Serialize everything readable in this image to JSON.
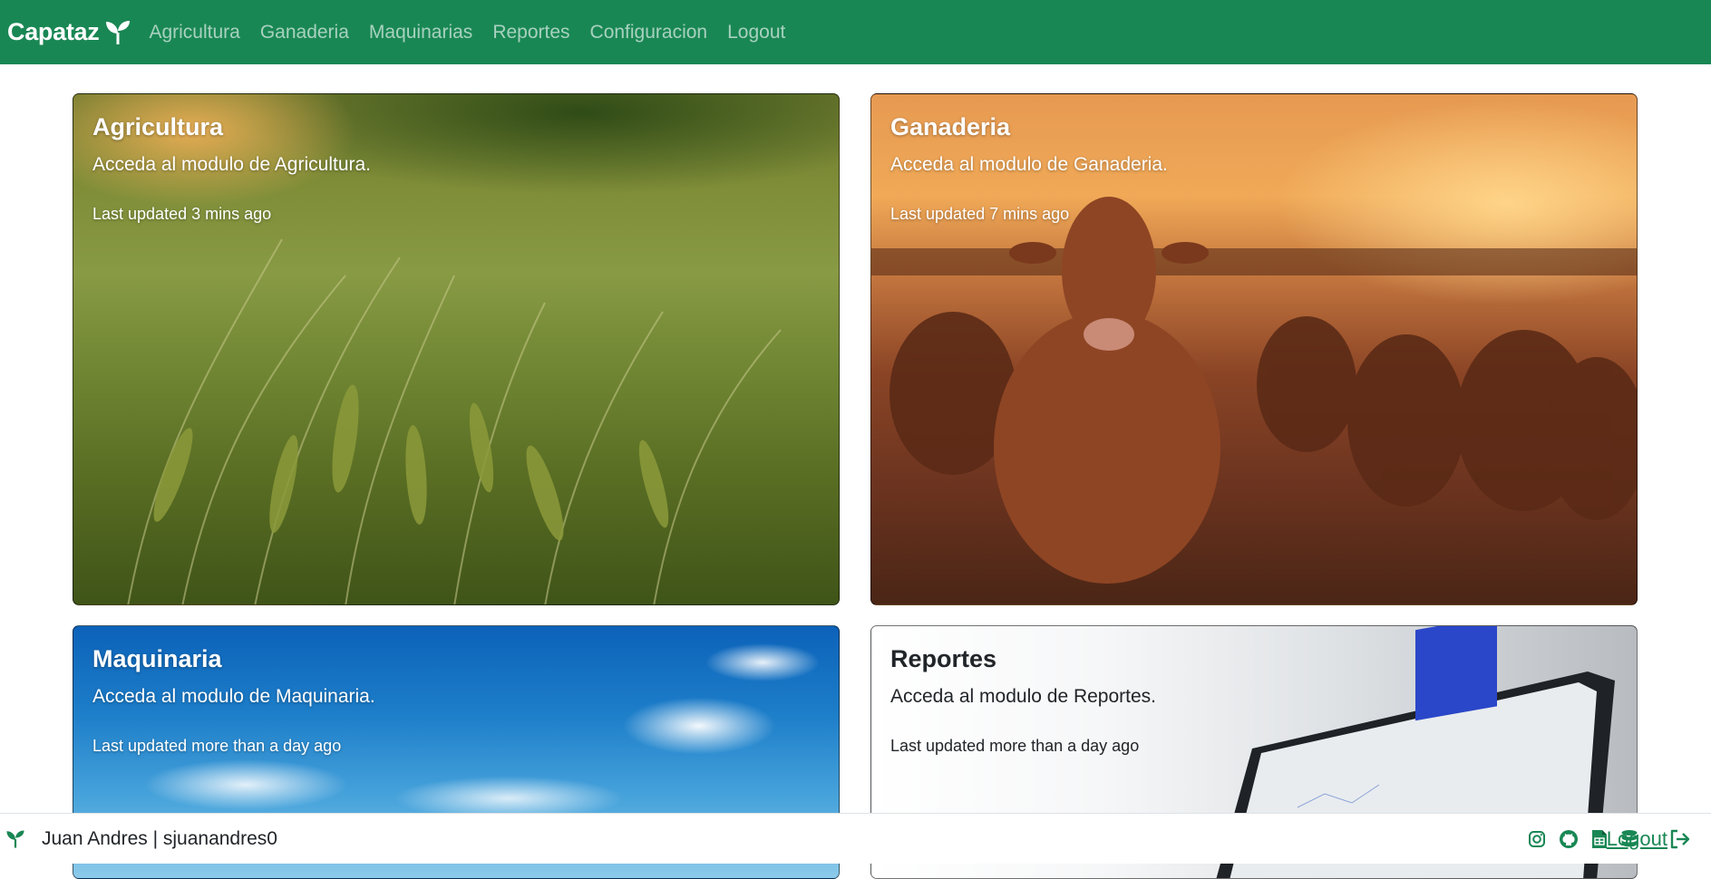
{
  "navbar": {
    "brand": "Capataz",
    "brand_icon": "seedling-icon",
    "links": [
      "Agricultura",
      "Ganaderia",
      "Maquinarias",
      "Reportes",
      "Configuracion",
      "Logout"
    ]
  },
  "cards": [
    {
      "title": "Agricultura",
      "text": "Acceda al modulo de Agricultura.",
      "meta": "Last updated 3 mins ago",
      "image": "wheat-field"
    },
    {
      "title": "Ganaderia",
      "text": "Acceda al modulo de Ganaderia.",
      "meta": "Last updated 7 mins ago",
      "image": "cattle-sunset"
    },
    {
      "title": "Maquinaria",
      "text": "Acceda al modulo de Maquinaria.",
      "meta": "Last updated more than a day ago",
      "image": "blue-sky-clouds"
    },
    {
      "title": "Reportes",
      "text": "Acceda al modulo de Reportes.",
      "meta": "Last updated more than a day ago",
      "image": "laptop-report"
    }
  ],
  "footer": {
    "user": "Juan Andres | sjuanandres0",
    "icons": [
      "instagram-icon",
      "github-icon",
      "spreadsheet-icon",
      "database-icon"
    ],
    "logout": "Logout"
  },
  "colors": {
    "primary": "#198754",
    "nav_link": "rgba(255,255,255,0.62)",
    "text_dark": "#212529"
  }
}
